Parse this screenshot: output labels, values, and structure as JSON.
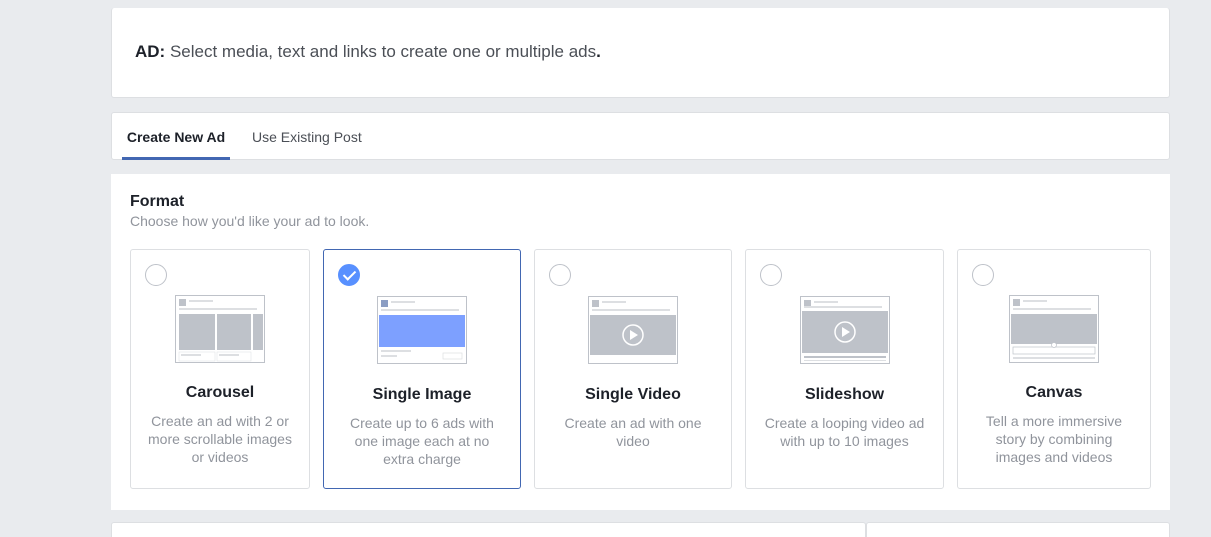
{
  "header": {
    "prefix": "AD:",
    "text": "Select media, text and links to create one or multiple ads",
    "suffix": "."
  },
  "tabs": [
    {
      "label": "Create New Ad",
      "active": true
    },
    {
      "label": "Use Existing Post",
      "active": false
    }
  ],
  "format": {
    "title": "Format",
    "subtitle": "Choose how you'd like your ad to look.",
    "accent_color": "#4267b2",
    "cards": [
      {
        "title": "Carousel",
        "description": "Create an ad with 2 or more scrollable images or videos",
        "selected": false,
        "icon": "carousel-preview-icon"
      },
      {
        "title": "Single Image",
        "description": "Create up to 6 ads with one image each at no extra charge",
        "selected": true,
        "icon": "single-image-preview-icon"
      },
      {
        "title": "Single Video",
        "description": "Create an ad with one video",
        "selected": false,
        "icon": "single-video-preview-icon"
      },
      {
        "title": "Slideshow",
        "description": "Create a looping video ad with up to 10 images",
        "selected": false,
        "icon": "slideshow-preview-icon"
      },
      {
        "title": "Canvas",
        "description": "Tell a more immersive story by combining images and videos",
        "selected": false,
        "icon": "canvas-preview-icon"
      }
    ]
  }
}
